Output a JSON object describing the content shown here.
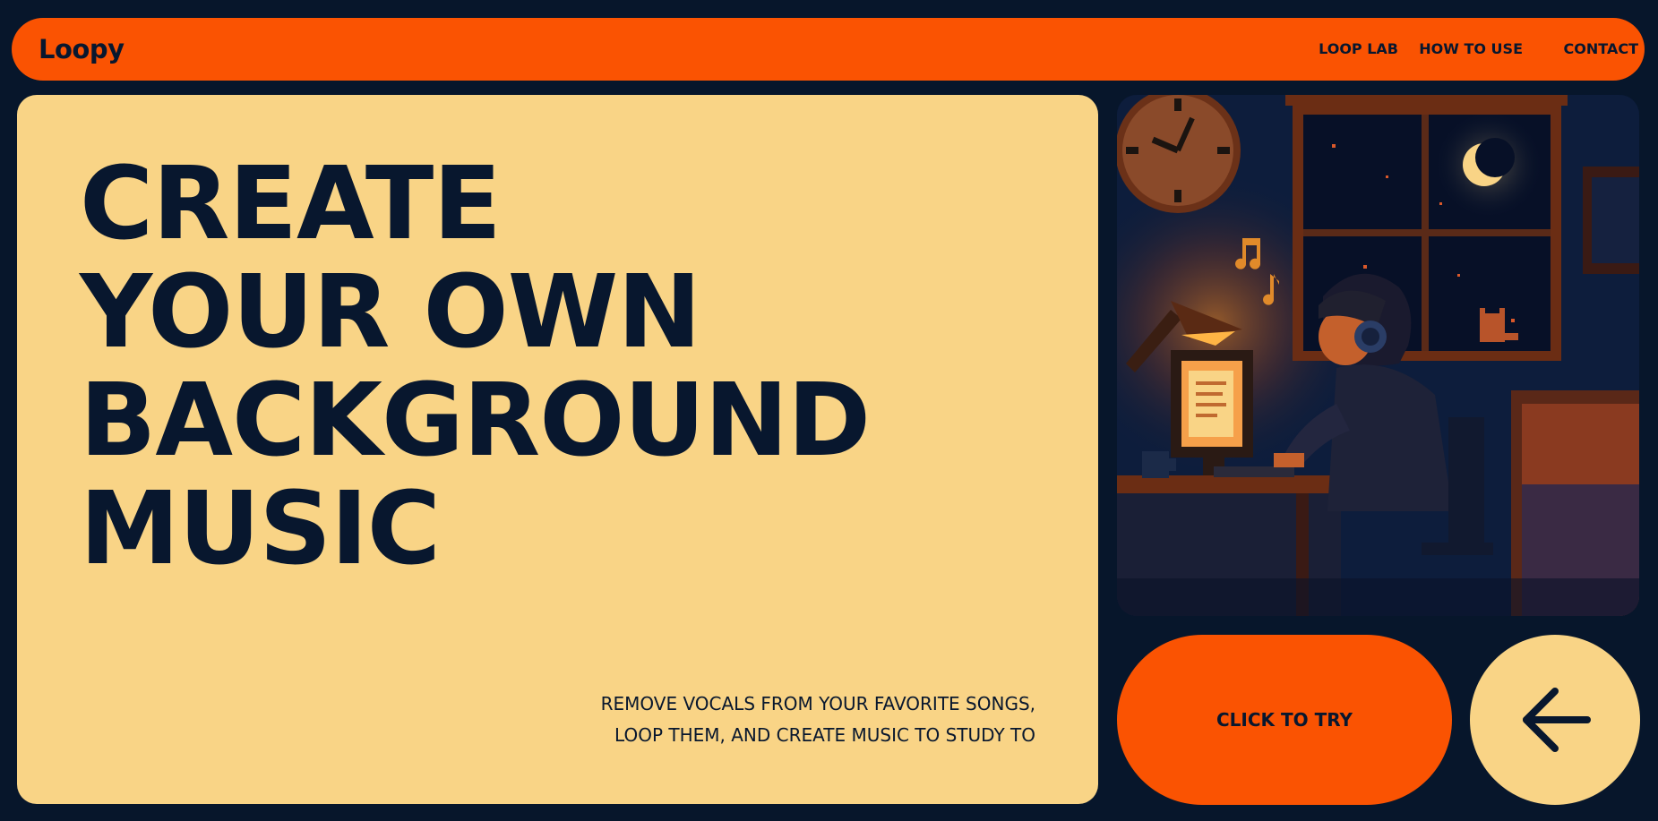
{
  "brand": {
    "name": "Loopy"
  },
  "nav": {
    "items": [
      "LOOP LAB",
      "HOW TO USE",
      "CONTACT"
    ]
  },
  "hero": {
    "title_lines": [
      "CREATE",
      "YOUR OWN",
      "BACKGROUND",
      "MUSIC"
    ],
    "subtitle_lines": [
      "REMOVE VOCALS FROM YOUR FAVORITE SONGS,",
      "LOOP THEM, AND CREATE MUSIC TO STUDY TO"
    ]
  },
  "cta": {
    "label": "CLICK TO TRY"
  },
  "icons": {
    "arrow": "arrow-left-icon"
  },
  "colors": {
    "background": "#07162b",
    "accent": "#fa5302",
    "card": "#f9d486",
    "text": "#08172e"
  }
}
